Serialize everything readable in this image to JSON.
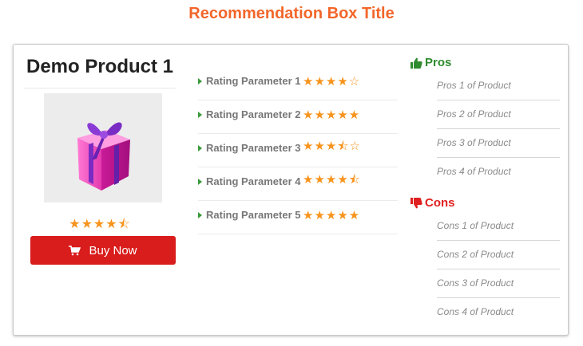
{
  "page": {
    "title": "Recommendation Box Title"
  },
  "product": {
    "name": "Demo Product 1",
    "image_icon": "gift-box-icon",
    "rating_stars": "★★★★⯪",
    "buy_label": "Buy Now",
    "buy_icon": "cart-icon"
  },
  "ratings": [
    {
      "label": "Rating Parameter 1",
      "stars": "★★★★☆",
      "value": 4
    },
    {
      "label": "Rating Parameter 2",
      "stars": "★★★★★",
      "value": 5
    },
    {
      "label": "Rating Parameter 3",
      "stars": "★★★⯪☆",
      "value": 3.5
    },
    {
      "label": "Rating Parameter 4",
      "stars": "★★★★⯪",
      "value": 4.5
    },
    {
      "label": "Rating Parameter 5",
      "stars": "★★★★★",
      "value": 5
    }
  ],
  "pros": {
    "heading": "Pros",
    "icon": "thumbs-up-icon",
    "color": "#2e8b2e",
    "items": [
      "Pros 1 of Product",
      "Pros 2 of Product",
      "Pros 3 of Product",
      "Pros 4 of Product"
    ]
  },
  "cons": {
    "heading": "Cons",
    "icon": "thumbs-down-icon",
    "color": "#e02020",
    "items": [
      "Cons 1 of Product",
      "Cons 2 of Product",
      "Cons 3 of Product",
      "Cons 4 of Product"
    ]
  },
  "colors": {
    "title": "#f2662a",
    "button": "#d91c1c",
    "star": "#f7941d"
  }
}
